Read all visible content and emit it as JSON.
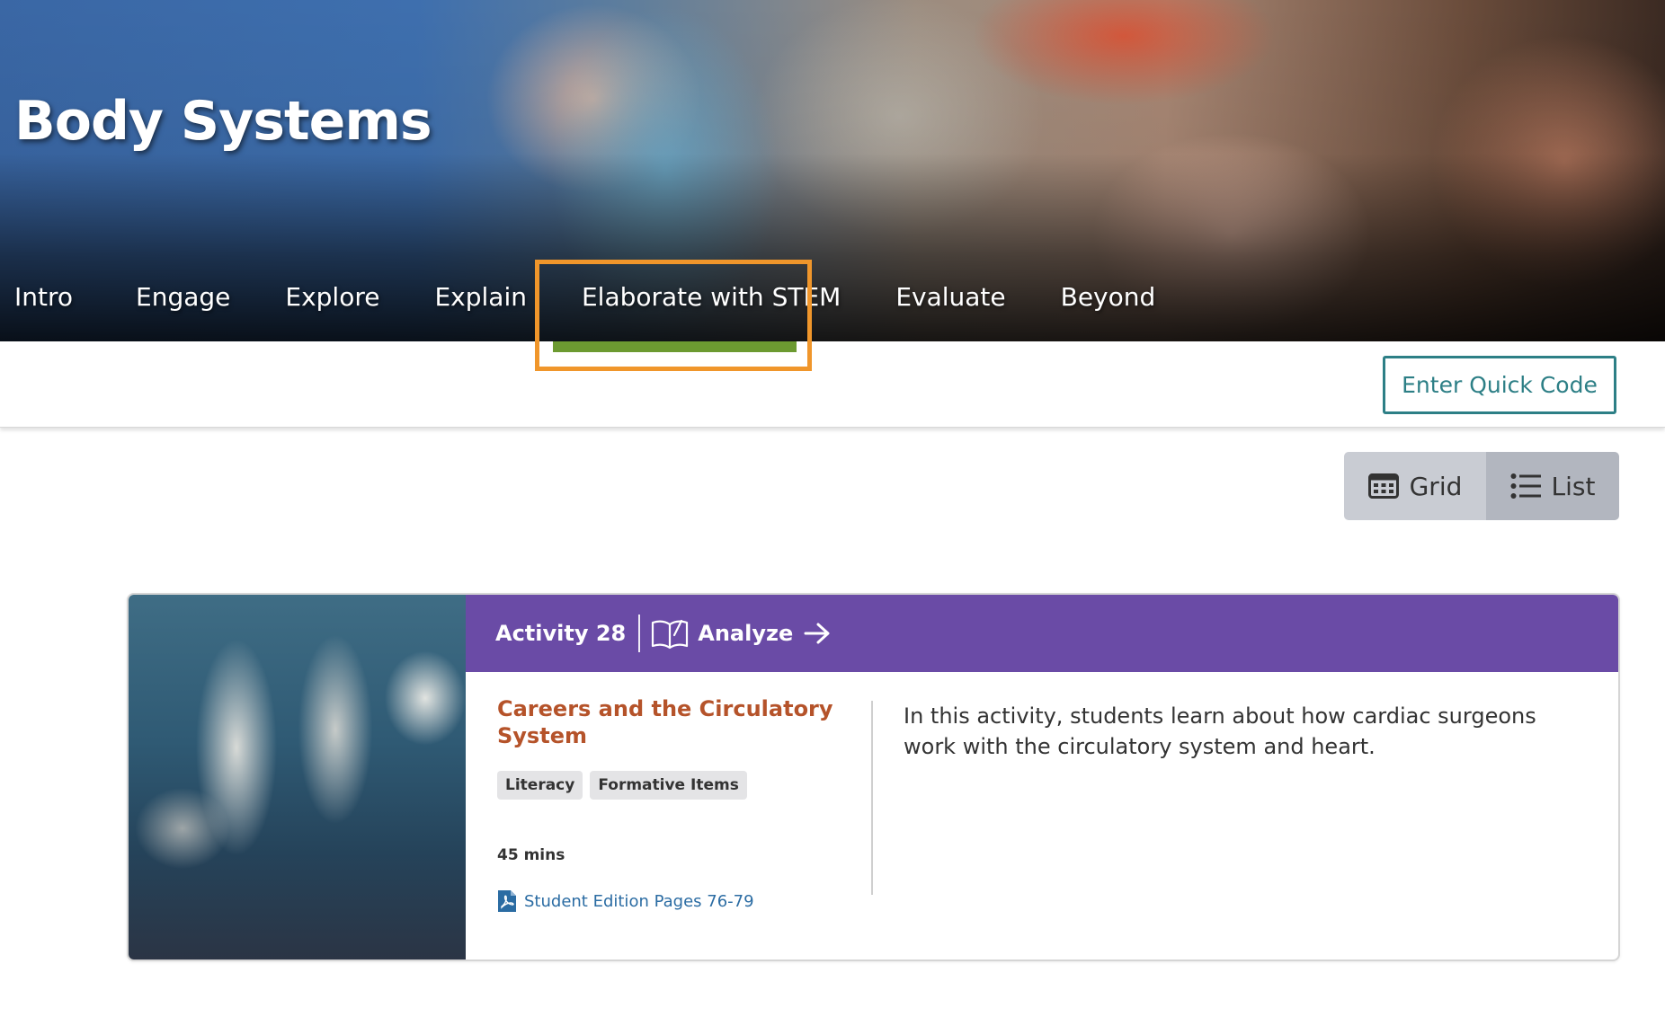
{
  "hero": {
    "title": "Body Systems"
  },
  "tabs": [
    {
      "label": "Intro"
    },
    {
      "label": "Engage"
    },
    {
      "label": "Explore"
    },
    {
      "label": "Explain"
    },
    {
      "label": "Elaborate with STEM",
      "active": true
    },
    {
      "label": "Evaluate"
    },
    {
      "label": "Beyond"
    }
  ],
  "toolbar": {
    "quick_code_label": "Enter Quick Code"
  },
  "view_toggle": {
    "grid_label": "Grid",
    "list_label": "List",
    "selected": "List"
  },
  "activity": {
    "number_label": "Activity 28",
    "type_label": "Analyze",
    "type_icon": "open-book-icon",
    "title": "Careers and the Circulatory System",
    "tags": [
      "Literacy",
      "Formative Items"
    ],
    "duration": "45 mins",
    "link_label": "Student Edition Pages 76-79",
    "link_icon": "pdf-icon",
    "description": "In this activity, students learn about how cardiac surgeons work with the circulatory system and heart."
  },
  "colors": {
    "active_tab_underline": "#6c9a31",
    "highlight_box": "#f0962b",
    "card_header": "#6a4ba6",
    "activity_title": "#b5532a",
    "quick_code": "#2d7f86",
    "link": "#2b6ca3"
  }
}
